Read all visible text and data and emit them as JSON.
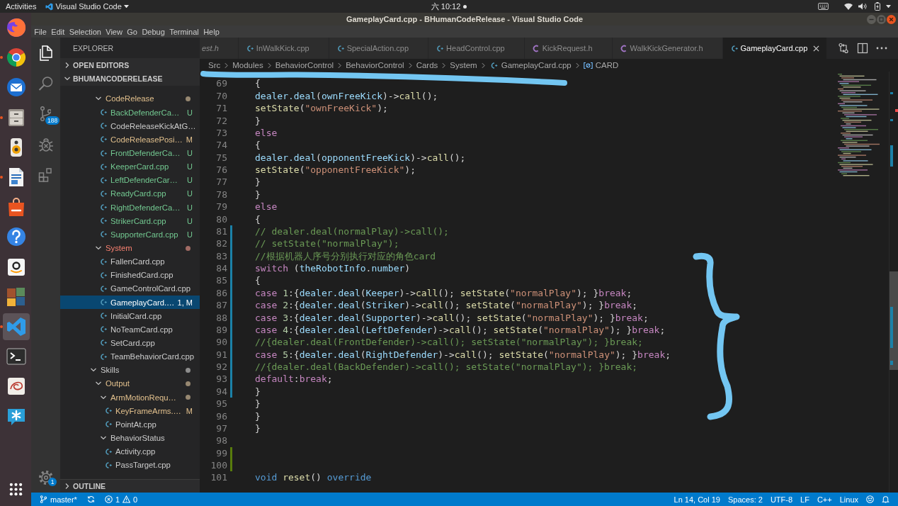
{
  "top_bar": {
    "activities": "Activities",
    "app_menu": "Visual Studio Code",
    "clock": "六 10:12",
    "notification": true
  },
  "dock": [
    {
      "running": false,
      "selected": false
    },
    {
      "running": true,
      "selected": false
    },
    {
      "running": false,
      "selected": false
    },
    {
      "running": true,
      "selected": false
    },
    {
      "running": false,
      "selected": false
    },
    {
      "running": true,
      "selected": false
    },
    {
      "running": false,
      "selected": false
    },
    {
      "running": false,
      "selected": false
    },
    {
      "running": false,
      "selected": false
    },
    {
      "running": false,
      "selected": false
    },
    {
      "running": true,
      "selected": true
    },
    {
      "running": false,
      "selected": false
    },
    {
      "running": false,
      "selected": false
    },
    {
      "running": false,
      "selected": false
    }
  ],
  "window": {
    "title": "GameplayCard.cpp - BHumanCodeRelease - Visual Studio Code"
  },
  "menu": [
    "File",
    "Edit",
    "Selection",
    "View",
    "Go",
    "Debug",
    "Terminal",
    "Help"
  ],
  "activity_bar": {
    "items": [
      {
        "selected": true
      },
      {
        "selected": false
      },
      {
        "selected": false,
        "badge": "188"
      },
      {
        "selected": false
      },
      {
        "selected": false
      }
    ],
    "manage": {
      "badge": "1"
    }
  },
  "sidebar": {
    "title": "EXPLORER",
    "open_editors": {
      "title": "OPEN EDITORS",
      "expanded": false
    },
    "folder": {
      "title": "BHUMANCODERELEASE",
      "expanded": true,
      "tree": [
        {
          "children": [
            {
              "kind": "folder",
              "label": "CodeRelease",
              "expanded": true,
              "dot": true,
              "selected": false,
              "color": "#e2c08d",
              "children": [
                {
                  "kind": "file",
                  "label": "BackDefenderCa…",
                  "badge": "U",
                  "selected": false,
                  "color": "#73c991"
                },
                {
                  "kind": "file",
                  "label": "CodeReleaseKickAtG…",
                  "selected": false,
                  "color": "#cccccc"
                },
                {
                  "kind": "file",
                  "label": "CodeReleasePosi…",
                  "badge": "M",
                  "selected": false,
                  "color": "#e2c08d"
                },
                {
                  "kind": "file",
                  "label": "FrontDefenderCa…",
                  "badge": "U",
                  "selected": false,
                  "color": "#73c991"
                },
                {
                  "kind": "file",
                  "label": "KeeperCard.cpp",
                  "badge": "U",
                  "selected": false,
                  "color": "#73c991"
                },
                {
                  "kind": "file",
                  "label": "LeftDefenderCar…",
                  "badge": "U",
                  "selected": false,
                  "color": "#73c991"
                },
                {
                  "kind": "file",
                  "label": "ReadyCard.cpp",
                  "badge": "U",
                  "selected": false,
                  "color": "#73c991"
                },
                {
                  "kind": "file",
                  "label": "RightDefenderCa…",
                  "badge": "U",
                  "selected": false,
                  "color": "#73c991"
                },
                {
                  "kind": "file",
                  "label": "StrikerCard.cpp",
                  "badge": "U",
                  "selected": false,
                  "color": "#73c991"
                },
                {
                  "kind": "file",
                  "label": "SupporterCard.cpp",
                  "badge": "U",
                  "selected": false,
                  "color": "#73c991"
                }
              ]
            },
            {
              "kind": "folder",
              "label": "System",
              "expanded": true,
              "dot": true,
              "selected": false,
              "color": "#f88070",
              "children": [
                {
                  "kind": "file",
                  "label": "FallenCard.cpp",
                  "selected": false,
                  "color": "#cccccc"
                },
                {
                  "kind": "file",
                  "label": "FinishedCard.cpp",
                  "selected": false,
                  "color": "#cccccc"
                },
                {
                  "kind": "file",
                  "label": "GameControlCard.cpp",
                  "selected": false,
                  "color": "#cccccc"
                },
                {
                  "kind": "file",
                  "label": "GameplayCard.…",
                  "badge": "1, M",
                  "selected": true,
                  "color": "#ffffff"
                },
                {
                  "kind": "file",
                  "label": "InitialCard.cpp",
                  "selected": false,
                  "color": "#cccccc"
                },
                {
                  "kind": "file",
                  "label": "NoTeamCard.cpp",
                  "selected": false,
                  "color": "#cccccc"
                },
                {
                  "kind": "file",
                  "label": "SetCard.cpp",
                  "selected": false,
                  "color": "#cccccc"
                },
                {
                  "kind": "file",
                  "label": "TeamBehaviorCard.cpp",
                  "selected": false,
                  "color": "#cccccc"
                }
              ]
            }
          ]
        },
        {
          "kind": "folder",
          "label": "Skills",
          "expanded": true,
          "dot": true,
          "selected": false,
          "color": "#cccccc",
          "children": [
            {
              "kind": "folder",
              "label": "Output",
              "expanded": true,
              "dot": true,
              "selected": false,
              "color": "#e2c08d",
              "children": [
                {
                  "kind": "folder",
                  "label": "ArmMotionRequ…",
                  "expanded": true,
                  "dot": true,
                  "selected": false,
                  "color": "#e2c08d",
                  "children": [
                    {
                      "kind": "file",
                      "label": "KeyFrameArms.…",
                      "badge": "M",
                      "selected": false,
                      "color": "#e2c08d"
                    },
                    {
                      "kind": "file",
                      "label": "PointAt.cpp",
                      "selected": false,
                      "color": "#cccccc"
                    }
                  ]
                },
                {
                  "kind": "folder",
                  "label": "BehaviorStatus",
                  "expanded": true,
                  "dot": false,
                  "selected": false,
                  "color": "#cccccc",
                  "children": [
                    {
                      "kind": "file",
                      "label": "Activity.cpp",
                      "selected": false,
                      "color": "#cccccc"
                    },
                    {
                      "kind": "file",
                      "label": "PassTarget.cpp",
                      "selected": false,
                      "color": "#cccccc"
                    }
                  ]
                }
              ]
            }
          ]
        }
      ]
    },
    "outline": {
      "title": "OUTLINE",
      "expanded": false
    }
  },
  "editor": {
    "tabs": [
      {
        "label": "est.h",
        "preview": true,
        "selected": false
      },
      {
        "label": "InWalkKick.cpp",
        "kind": "cpp",
        "preview": false,
        "selected": false
      },
      {
        "label": "SpecialAction.cpp",
        "kind": "cpp",
        "preview": false,
        "selected": false
      },
      {
        "label": "HeadControl.cpp",
        "kind": "cpp",
        "preview": false,
        "selected": false
      },
      {
        "label": "KickRequest.h",
        "kind": "header",
        "preview": false,
        "selected": false
      },
      {
        "label": "WalkKickGenerator.h",
        "kind": "header",
        "preview": false,
        "selected": false
      },
      {
        "label": "GameplayCard.cpp",
        "kind": "cpp",
        "preview": false,
        "selected": true
      }
    ],
    "breadcrumbs": [
      {
        "label": "Src",
        "kind": "folder"
      },
      {
        "label": "Modules",
        "kind": "folder"
      },
      {
        "label": "BehaviorControl",
        "kind": "folder"
      },
      {
        "label": "BehaviorControl",
        "kind": "folder"
      },
      {
        "label": "Cards",
        "kind": "folder"
      },
      {
        "label": "System",
        "kind": "folder"
      },
      {
        "label": "GameplayCard.cpp",
        "kind": "file"
      },
      {
        "label": "CARD",
        "kind": "symbol"
      }
    ],
    "lines": [
      {
        "n": "69",
        "modified": false,
        "added": false,
        "tokens": [
          {
            "text": "      {",
            "kind": "plain"
          }
        ]
      },
      {
        "n": "70",
        "modified": false,
        "added": false,
        "tokens": [
          {
            "text": "        dealer.deal",
            "kind": "variable"
          },
          {
            "text": "(",
            "kind": "plain"
          },
          {
            "text": "ownFreeKick",
            "kind": "variable"
          },
          {
            "text": ")->",
            "kind": "plain"
          },
          {
            "text": "call",
            "kind": "function"
          },
          {
            "text": "();",
            "kind": "plain"
          }
        ]
      },
      {
        "n": "71",
        "modified": false,
        "added": false,
        "tokens": [
          {
            "text": "        setState",
            "kind": "function"
          },
          {
            "text": "(",
            "kind": "plain"
          },
          {
            "text": "\"ownFreeKick\"",
            "kind": "string"
          },
          {
            "text": ");",
            "kind": "plain"
          }
        ]
      },
      {
        "n": "72",
        "modified": false,
        "added": false,
        "tokens": [
          {
            "text": "      }",
            "kind": "plain"
          }
        ]
      },
      {
        "n": "73",
        "modified": false,
        "added": false,
        "tokens": [
          {
            "text": "      else",
            "kind": "control"
          }
        ]
      },
      {
        "n": "74",
        "modified": false,
        "added": false,
        "tokens": [
          {
            "text": "      {",
            "kind": "plain"
          }
        ]
      },
      {
        "n": "75",
        "modified": false,
        "added": false,
        "tokens": [
          {
            "text": "        dealer.deal",
            "kind": "variable"
          },
          {
            "text": "(",
            "kind": "plain"
          },
          {
            "text": "opponentFreeKick",
            "kind": "variable"
          },
          {
            "text": ")->",
            "kind": "plain"
          },
          {
            "text": "call",
            "kind": "function"
          },
          {
            "text": "();",
            "kind": "plain"
          }
        ]
      },
      {
        "n": "76",
        "modified": false,
        "added": false,
        "tokens": [
          {
            "text": "        setState",
            "kind": "function"
          },
          {
            "text": "(",
            "kind": "plain"
          },
          {
            "text": "\"opponentFreeKick\"",
            "kind": "string"
          },
          {
            "text": ");",
            "kind": "plain"
          }
        ]
      },
      {
        "n": "77",
        "modified": false,
        "added": false,
        "tokens": [
          {
            "text": "      }",
            "kind": "plain"
          }
        ]
      },
      {
        "n": "78",
        "modified": false,
        "added": false,
        "tokens": [
          {
            "text": "    }",
            "kind": "plain"
          }
        ]
      },
      {
        "n": "79",
        "modified": false,
        "added": false,
        "tokens": [
          {
            "text": "    else",
            "kind": "control"
          }
        ]
      },
      {
        "n": "80",
        "modified": false,
        "added": false,
        "tokens": [
          {
            "text": "    {",
            "kind": "plain"
          }
        ]
      },
      {
        "n": "81",
        "modified": true,
        "added": false,
        "tokens": [
          {
            "text": "      // dealer.deal(normalPlay)->call();",
            "kind": "comment"
          }
        ]
      },
      {
        "n": "82",
        "modified": true,
        "added": false,
        "tokens": [
          {
            "text": "      // setState(\"normalPlay\");",
            "kind": "comment"
          }
        ]
      },
      {
        "n": "83",
        "modified": true,
        "added": false,
        "tokens": [
          {
            "text": "      //根据机器人序号分别执行对应的角色card",
            "kind": "comment"
          }
        ]
      },
      {
        "n": "84",
        "modified": true,
        "added": false,
        "tokens": [
          {
            "text": "       switch",
            "kind": "control"
          },
          {
            "text": " (",
            "kind": "plain"
          },
          {
            "text": "theRobotInfo",
            "kind": "variable"
          },
          {
            "text": ".",
            "kind": "plain"
          },
          {
            "text": "number",
            "kind": "variable"
          },
          {
            "text": ")",
            "kind": "plain"
          }
        ]
      },
      {
        "n": "85",
        "modified": true,
        "added": false,
        "tokens": [
          {
            "text": "    {",
            "kind": "plain"
          }
        ]
      },
      {
        "n": "86",
        "modified": true,
        "added": false,
        "tokens": [
          {
            "text": "    case",
            "kind": "control"
          },
          {
            "text": " 1",
            "kind": "number"
          },
          {
            "text": ":{",
            "kind": "plain"
          },
          {
            "text": "dealer.deal",
            "kind": "variable"
          },
          {
            "text": "(",
            "kind": "plain"
          },
          {
            "text": "Keeper",
            "kind": "variable"
          },
          {
            "text": ")->",
            "kind": "plain"
          },
          {
            "text": "call",
            "kind": "function"
          },
          {
            "text": "(); ",
            "kind": "plain"
          },
          {
            "text": "setState",
            "kind": "function"
          },
          {
            "text": "(",
            "kind": "plain"
          },
          {
            "text": "\"normalPlay\"",
            "kind": "string"
          },
          {
            "text": "); }",
            "kind": "plain"
          },
          {
            "text": "break",
            "kind": "control"
          },
          {
            "text": ";",
            "kind": "plain"
          }
        ]
      },
      {
        "n": "87",
        "modified": true,
        "added": false,
        "tokens": [
          {
            "text": "    case",
            "kind": "control"
          },
          {
            "text": " 2",
            "kind": "number"
          },
          {
            "text": ":{",
            "kind": "plain"
          },
          {
            "text": "dealer.deal",
            "kind": "variable"
          },
          {
            "text": "(",
            "kind": "plain"
          },
          {
            "text": "Striker",
            "kind": "variable"
          },
          {
            "text": ")->",
            "kind": "plain"
          },
          {
            "text": "call",
            "kind": "function"
          },
          {
            "text": "(); ",
            "kind": "plain"
          },
          {
            "text": "setState",
            "kind": "function"
          },
          {
            "text": "(",
            "kind": "plain"
          },
          {
            "text": "\"normalPlay\"",
            "kind": "string"
          },
          {
            "text": "); }",
            "kind": "plain"
          },
          {
            "text": "break",
            "kind": "control"
          },
          {
            "text": ";",
            "kind": "plain"
          }
        ]
      },
      {
        "n": "88",
        "modified": true,
        "added": false,
        "tokens": [
          {
            "text": "    case",
            "kind": "control"
          },
          {
            "text": " 3",
            "kind": "number"
          },
          {
            "text": ":{",
            "kind": "plain"
          },
          {
            "text": "dealer.deal",
            "kind": "variable"
          },
          {
            "text": "(",
            "kind": "plain"
          },
          {
            "text": "Supporter",
            "kind": "variable"
          },
          {
            "text": ")->",
            "kind": "plain"
          },
          {
            "text": "call",
            "kind": "function"
          },
          {
            "text": "(); ",
            "kind": "plain"
          },
          {
            "text": "setState",
            "kind": "function"
          },
          {
            "text": "(",
            "kind": "plain"
          },
          {
            "text": "\"normalPlay\"",
            "kind": "string"
          },
          {
            "text": "); }",
            "kind": "plain"
          },
          {
            "text": "break",
            "kind": "control"
          },
          {
            "text": ";",
            "kind": "plain"
          }
        ]
      },
      {
        "n": "89",
        "modified": true,
        "added": false,
        "tokens": [
          {
            "text": "    case",
            "kind": "control"
          },
          {
            "text": " 4",
            "kind": "number"
          },
          {
            "text": ":{",
            "kind": "plain"
          },
          {
            "text": "dealer.deal",
            "kind": "variable"
          },
          {
            "text": "(",
            "kind": "plain"
          },
          {
            "text": "LeftDefender",
            "kind": "variable"
          },
          {
            "text": ")->",
            "kind": "plain"
          },
          {
            "text": "call",
            "kind": "function"
          },
          {
            "text": "(); ",
            "kind": "plain"
          },
          {
            "text": "setState",
            "kind": "function"
          },
          {
            "text": "(",
            "kind": "plain"
          },
          {
            "text": "\"normalPlay\"",
            "kind": "string"
          },
          {
            "text": "); }",
            "kind": "plain"
          },
          {
            "text": "break",
            "kind": "control"
          },
          {
            "text": ";",
            "kind": "plain"
          }
        ]
      },
      {
        "n": "90",
        "modified": true,
        "added": false,
        "tokens": [
          {
            "text": "           //{dealer.deal(FrontDefender)->call(); setState(\"normalPlay\"); }break;",
            "kind": "comment"
          }
        ]
      },
      {
        "n": "91",
        "modified": true,
        "added": false,
        "tokens": [
          {
            "text": "    case",
            "kind": "control"
          },
          {
            "text": " 5",
            "kind": "number"
          },
          {
            "text": ":{",
            "kind": "plain"
          },
          {
            "text": "dealer.deal",
            "kind": "variable"
          },
          {
            "text": "(",
            "kind": "plain"
          },
          {
            "text": "RightDefender",
            "kind": "variable"
          },
          {
            "text": ")->",
            "kind": "plain"
          },
          {
            "text": "call",
            "kind": "function"
          },
          {
            "text": "(); ",
            "kind": "plain"
          },
          {
            "text": "setState",
            "kind": "function"
          },
          {
            "text": "(",
            "kind": "plain"
          },
          {
            "text": "\"normalPlay\"",
            "kind": "string"
          },
          {
            "text": "); }",
            "kind": "plain"
          },
          {
            "text": "break",
            "kind": "control"
          },
          {
            "text": ";",
            "kind": "plain"
          }
        ]
      },
      {
        "n": "92",
        "modified": true,
        "added": false,
        "tokens": [
          {
            "text": "           //{dealer.deal(BackDefender)->call(); setState(\"normalPlay\"); }break;",
            "kind": "comment"
          }
        ]
      },
      {
        "n": "93",
        "modified": true,
        "added": false,
        "tokens": [
          {
            "text": "    default",
            "kind": "control"
          },
          {
            "text": ":",
            "kind": "plain"
          },
          {
            "text": "break",
            "kind": "control"
          },
          {
            "text": ";",
            "kind": "plain"
          }
        ]
      },
      {
        "n": "94",
        "modified": true,
        "added": false,
        "tokens": [
          {
            "text": "    }",
            "kind": "plain"
          }
        ]
      },
      {
        "n": "95",
        "modified": false,
        "added": false,
        "tokens": [
          {
            "text": "    }",
            "kind": "plain"
          }
        ]
      },
      {
        "n": "96",
        "modified": false,
        "added": false,
        "tokens": [
          {
            "text": "  }",
            "kind": "plain"
          }
        ]
      },
      {
        "n": "97",
        "modified": false,
        "added": false,
        "tokens": [
          {
            "text": "}",
            "kind": "plain"
          }
        ]
      },
      {
        "n": "98",
        "modified": false,
        "added": false
      },
      {
        "n": "99",
        "modified": false,
        "added": true
      },
      {
        "n": "100",
        "modified": false,
        "added": true
      },
      {
        "n": "101",
        "modified": false,
        "added": false,
        "tokens": [
          {
            "text": "void",
            "kind": "keyword"
          },
          {
            "text": " reset",
            "kind": "function"
          },
          {
            "text": "() ",
            "kind": "plain"
          },
          {
            "text": "override",
            "kind": "keyword"
          }
        ]
      }
    ]
  },
  "status_bar": {
    "branch": "master*",
    "errors": "1",
    "warnings": "0",
    "position": "Ln 14, Col 19",
    "indentation": "Spaces: 2",
    "encoding": "UTF-8",
    "line_ending": "LF",
    "language": "C++",
    "configuration": "Linux"
  }
}
